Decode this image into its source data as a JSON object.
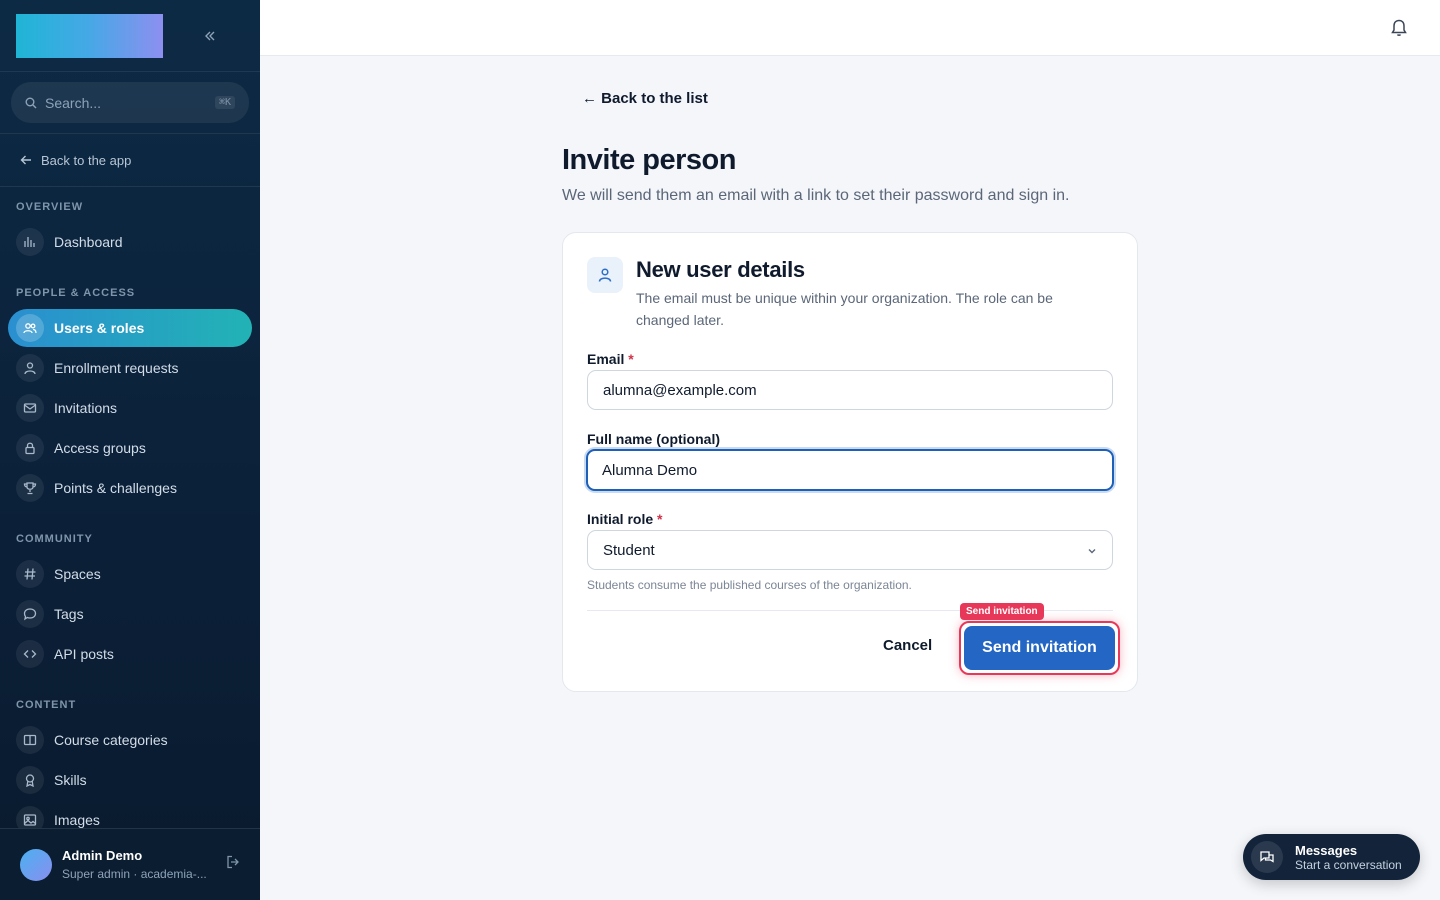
{
  "sidebar": {
    "search_placeholder": "Search...",
    "search_shortcut": "⌘K",
    "back_to_app": "Back to the app",
    "sections": {
      "overview": "OVERVIEW",
      "people": "PEOPLE & ACCESS",
      "community": "COMMUNITY",
      "content": "CONTENT"
    },
    "items": {
      "dashboard": "Dashboard",
      "users_roles": "Users & roles",
      "enrollment": "Enrollment requests",
      "invitations": "Invitations",
      "access_groups": "Access groups",
      "points": "Points & challenges",
      "spaces": "Spaces",
      "tags": "Tags",
      "api_posts": "API posts",
      "course_categories": "Course categories",
      "skills": "Skills",
      "images": "Images"
    },
    "active_item": "users_roles",
    "user": {
      "name": "Admin Demo",
      "role": "Super admin · academia-..."
    }
  },
  "main": {
    "back_link": "← Back to the list",
    "title": "Invite person",
    "subtitle": "We will send them an email with a link to set their password and sign in.",
    "card": {
      "title": "New user details",
      "description": "The email must be unique within your organization. The role can be changed later.",
      "email_label": "Email",
      "email_value": "alumna@example.com",
      "fullname_label": "Full name (optional)",
      "fullname_value": "Alumna Demo",
      "role_label": "Initial role",
      "role_value": "Student",
      "role_hint": "Students consume the published courses of the organization.",
      "required_mark": "*",
      "cancel_label": "Cancel",
      "send_label": "Send invitation",
      "send_tag": "Send invitation"
    }
  },
  "messages_widget": {
    "title": "Messages",
    "subtitle": "Start a conversation"
  },
  "colors": {
    "sidebar_bg": "#0d2a45",
    "accent_active": "#22b3b5",
    "primary_button": "#2366c4",
    "highlight": "#e8385a"
  }
}
